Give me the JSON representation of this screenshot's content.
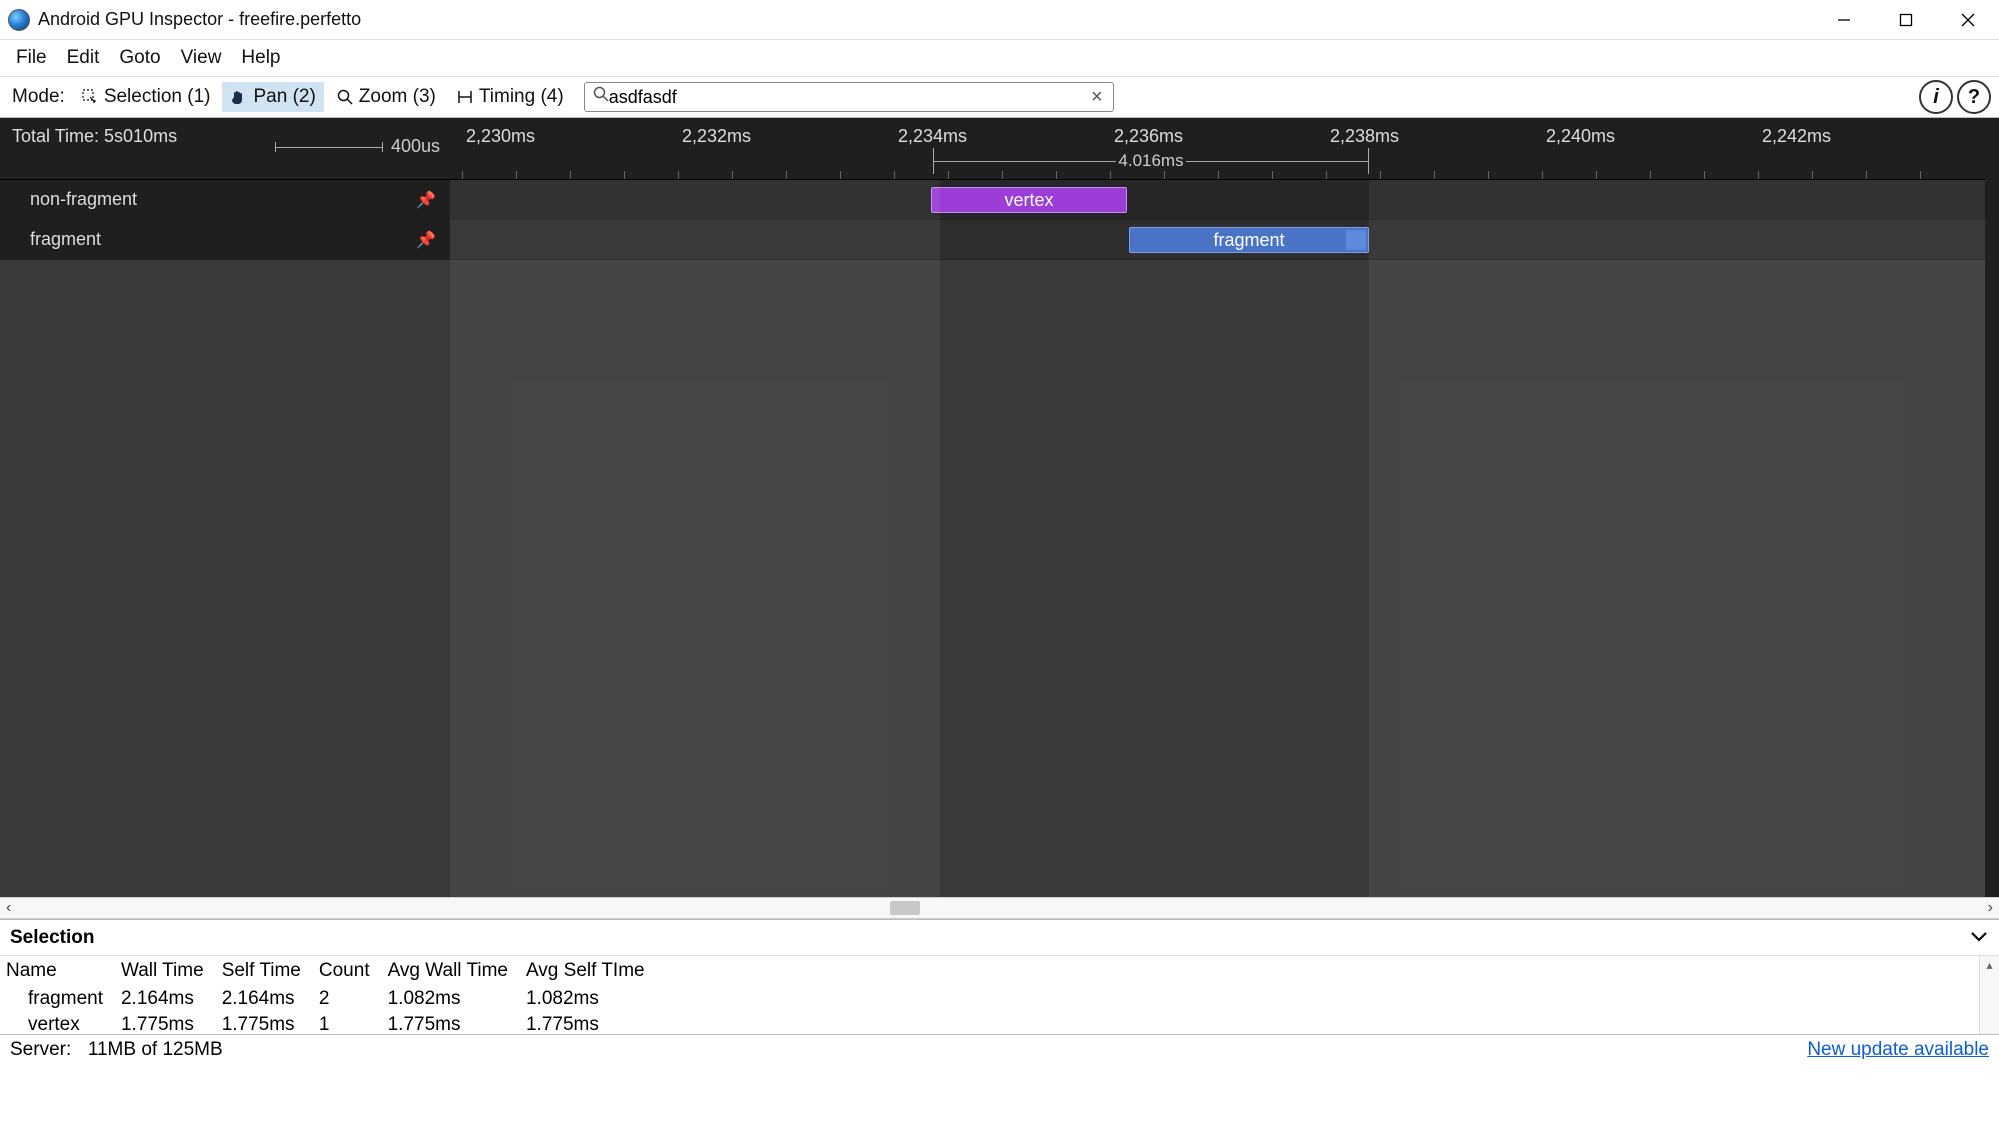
{
  "window": {
    "title": "Android GPU Inspector - freefire.perfetto"
  },
  "menu": [
    "File",
    "Edit",
    "Goto",
    "View",
    "Help"
  ],
  "toolbar": {
    "mode_label": "Mode:",
    "modes": [
      {
        "label": "Selection (1)",
        "icon": "selection"
      },
      {
        "label": "Pan (2)",
        "icon": "pan",
        "active": true
      },
      {
        "label": "Zoom (3)",
        "icon": "zoom"
      },
      {
        "label": "Timing (4)",
        "icon": "timing"
      }
    ],
    "search_value": "asdfasdf"
  },
  "timeline": {
    "total_time_label": "Total Time: 5s010ms",
    "scale_label": "400us",
    "ticks": [
      "2,230ms",
      "2,232ms",
      "2,234ms",
      "2,236ms",
      "2,238ms",
      "2,240ms",
      "2,242ms"
    ],
    "range_label": "4.016ms",
    "tracks": [
      {
        "label": "non-fragment"
      },
      {
        "label": "fragment"
      }
    ],
    "slices": {
      "vertex_label": "vertex",
      "fragment_label": "fragment"
    }
  },
  "selection": {
    "title": "Selection",
    "columns": [
      "Name",
      "Wall Time",
      "Self Time",
      "Count",
      "Avg Wall Time",
      "Avg Self TIme"
    ],
    "rows": [
      {
        "name": "fragment",
        "wall": "2.164ms",
        "self": "2.164ms",
        "count": "2",
        "avg_wall": "1.082ms",
        "avg_self": "1.082ms"
      },
      {
        "name": "vertex",
        "wall": "1.775ms",
        "self": "1.775ms",
        "count": "1",
        "avg_wall": "1.775ms",
        "avg_self": "1.775ms"
      }
    ]
  },
  "status": {
    "server_label": "Server:",
    "memory": "11MB of 125MB",
    "update_link": "New update available"
  }
}
